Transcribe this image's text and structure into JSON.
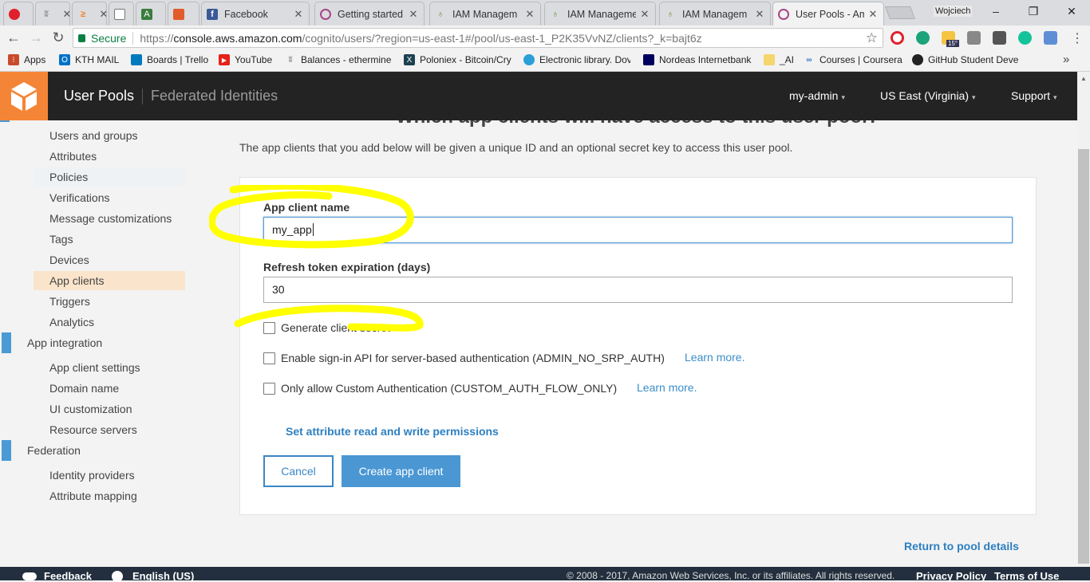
{
  "browser": {
    "tabs": [
      {
        "label": "",
        "icon": "opera-icon"
      },
      {
        "label": "",
        "icon": "balances-icon"
      },
      {
        "label": "",
        "icon": "stackoverflow-icon"
      },
      {
        "label": "",
        "icon": "page-icon"
      },
      {
        "label": "",
        "icon": "android-icon"
      },
      {
        "label": "",
        "icon": "office-icon"
      },
      {
        "label": "Facebook",
        "icon": "facebook-icon"
      },
      {
        "label": "Getting started",
        "icon": "cognito-icon"
      },
      {
        "label": "IAM Managem",
        "icon": "iam-icon"
      },
      {
        "label": "IAM Manageme",
        "icon": "iam-icon"
      },
      {
        "label": "IAM Managem",
        "icon": "iam-icon"
      },
      {
        "label": "User Pools - Am",
        "icon": "cognito-icon"
      }
    ],
    "profile": "Wojciech",
    "secure_label": "Secure",
    "url_scheme": "https://",
    "url_domain": "console.aws.amazon.com",
    "url_path": "/cognito/users/?region=us-east-1#/pool/us-east-1_P2K35VvNZ/clients?_k=bajt6z",
    "extension_badge": "15°",
    "bookmarks": [
      {
        "label": "Apps",
        "icon": "apps-icon",
        "color": "#c74b2a"
      },
      {
        "label": "KTH MAIL",
        "icon": "outlook-icon",
        "color": "#0072c6"
      },
      {
        "label": "Boards | Trello",
        "icon": "trello-icon",
        "color": "#0079bf"
      },
      {
        "label": "YouTube",
        "icon": "youtube-icon",
        "color": "#e62117"
      },
      {
        "label": "Balances - ethermine",
        "icon": "balances-icon",
        "color": "#777777"
      },
      {
        "label": "Poloniex - Bitcoin/Cry",
        "icon": "poloniex-icon",
        "color": "#1c4150"
      },
      {
        "label": "Electronic library. Dov",
        "icon": "library-icon",
        "color": "#2a9fd6"
      },
      {
        "label": "Nordeas Internetbank",
        "icon": "nordea-icon",
        "color": "#00005e"
      },
      {
        "label": "_AI",
        "icon": "folder-icon",
        "color": "#f5d66c"
      },
      {
        "label": "Courses | Coursera",
        "icon": "coursera-icon",
        "color": "#2a73cc"
      },
      {
        "label": "GitHub Student Deve",
        "icon": "github-icon",
        "color": "#222222"
      }
    ]
  },
  "header": {
    "title": "User Pools",
    "secondary": "Federated Identities",
    "account": "my-admin",
    "region": "US East (Virginia)",
    "support": "Support"
  },
  "sidebar": {
    "items": [
      {
        "label": "Users and groups"
      },
      {
        "label": "Attributes"
      },
      {
        "label": "Policies"
      },
      {
        "label": "Verifications"
      },
      {
        "label": "Message customizations"
      },
      {
        "label": "Tags"
      },
      {
        "label": "Devices"
      },
      {
        "label": "App clients"
      },
      {
        "label": "Triggers"
      },
      {
        "label": "Analytics"
      }
    ],
    "group_app_integration": "App integration",
    "app_integration_items": [
      {
        "label": "App client settings"
      },
      {
        "label": "Domain name"
      },
      {
        "label": "UI customization"
      },
      {
        "label": "Resource servers"
      }
    ],
    "group_federation": "Federation",
    "federation_items": [
      {
        "label": "Identity providers"
      },
      {
        "label": "Attribute mapping"
      }
    ]
  },
  "main": {
    "heading": "Which app clients will have access to this user pool?",
    "intro": "The app clients that you add below will be given a unique ID and an optional secret key to access this user pool.",
    "client_name_label": "App client name",
    "client_name_value": "my_app",
    "refresh_label": "Refresh token expiration (days)",
    "refresh_value": "30",
    "generate_secret_label": "Generate client secret",
    "signin_api_label": "Enable sign-in API for server-based authentication (ADMIN_NO_SRP_AUTH)",
    "custom_auth_label": "Only allow Custom Authentication (CUSTOM_AUTH_FLOW_ONLY)",
    "learn_more": "Learn more.",
    "attr_permissions": "Set attribute read and write permissions",
    "cancel": "Cancel",
    "create": "Create app client",
    "return_link": "Return to pool details"
  },
  "footer": {
    "feedback": "Feedback",
    "language": "English (US)",
    "copyright": "© 2008 - 2017, Amazon Web Services, Inc. or its affiliates. All rights reserved.",
    "privacy": "Privacy Policy",
    "terms": "Terms of Use"
  },
  "colors": {
    "aws_orange": "#f58536",
    "header_bg": "#232323",
    "link_blue": "#2d7fc0",
    "highlight_yellow": "#ffff00"
  }
}
